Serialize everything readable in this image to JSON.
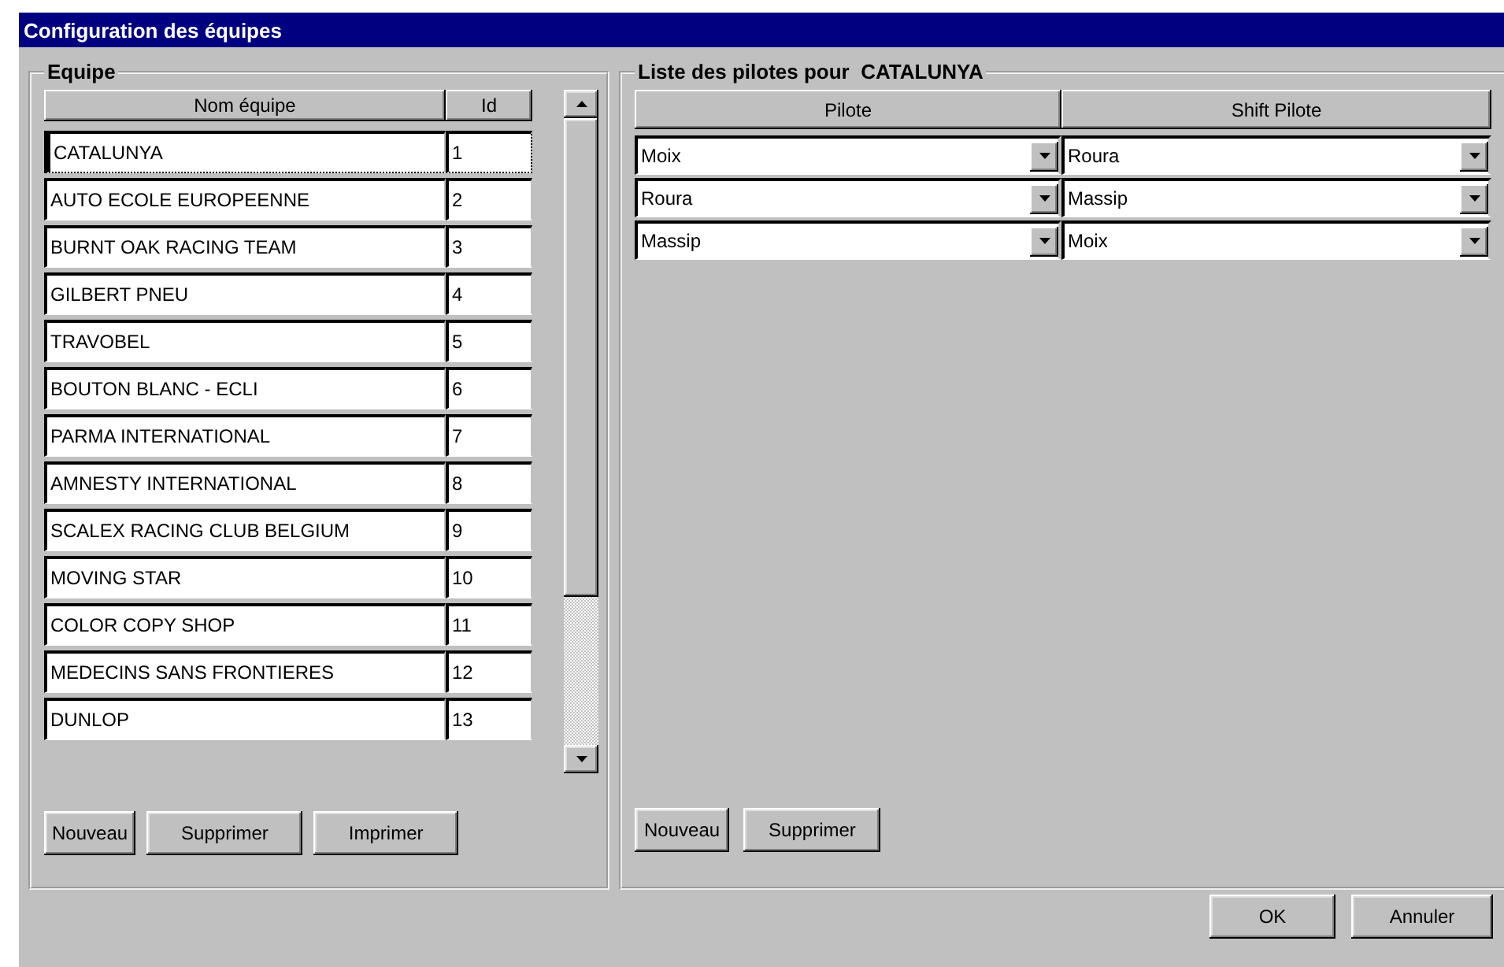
{
  "window": {
    "title": "Configuration des équipes"
  },
  "teams": {
    "title": "Equipe",
    "columns": [
      "Nom équipe",
      "Id"
    ],
    "rows": [
      {
        "name": "CATALUNYA",
        "id": "1",
        "selected": true
      },
      {
        "name": "AUTO ECOLE EUROPEENNE",
        "id": "2",
        "selected": false
      },
      {
        "name": "BURNT OAK RACING TEAM",
        "id": "3",
        "selected": false
      },
      {
        "name": "GILBERT PNEU",
        "id": "4",
        "selected": false
      },
      {
        "name": "TRAVOBEL",
        "id": "5",
        "selected": false
      },
      {
        "name": "BOUTON BLANC - ECLI",
        "id": "6",
        "selected": false
      },
      {
        "name": "PARMA INTERNATIONAL",
        "id": "7",
        "selected": false
      },
      {
        "name": "AMNESTY INTERNATIONAL",
        "id": "8",
        "selected": false
      },
      {
        "name": "SCALEX RACING CLUB BELGIUM",
        "id": "9",
        "selected": false
      },
      {
        "name": "MOVING STAR",
        "id": "10",
        "selected": false
      },
      {
        "name": "COLOR COPY SHOP",
        "id": "11",
        "selected": false
      },
      {
        "name": "MEDECINS SANS FRONTIERES",
        "id": "12",
        "selected": false
      },
      {
        "name": "DUNLOP",
        "id": "13",
        "selected": false
      }
    ],
    "buttons": [
      "Nouveau",
      "Supprimer",
      "Imprimer"
    ]
  },
  "pilots": {
    "title": "Liste des pilotes pour  CATALUNYA",
    "columns": [
      "Pilote",
      "Shift Pilote"
    ],
    "rows": [
      {
        "pilot": "Moix",
        "shift_pilot": "Roura"
      },
      {
        "pilot": "Roura",
        "shift_pilot": "Massip"
      },
      {
        "pilot": "Massip",
        "shift_pilot": "Moix"
      }
    ],
    "buttons": [
      "Nouveau",
      "Supprimer"
    ]
  },
  "buttons": [
    "OK",
    "Annuler"
  ]
}
